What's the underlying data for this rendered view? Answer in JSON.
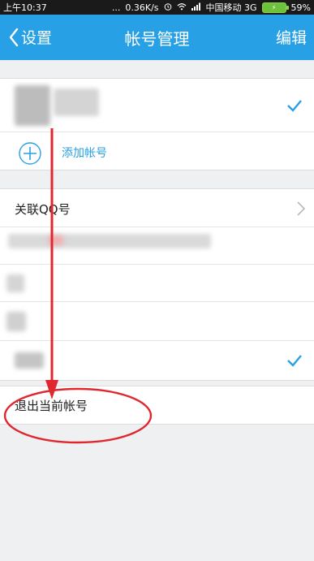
{
  "status_bar": {
    "time": "上午10:37",
    "dots": "...",
    "net_speed": "0.36K/s",
    "carrier": "中国移动 3G",
    "battery": "59%"
  },
  "nav": {
    "back_label": "设置",
    "title": "帐号管理",
    "edit_label": "编辑"
  },
  "accounts": {
    "add_label": "添加帐号"
  },
  "linked": {
    "label": "关联QQ号"
  },
  "logout": {
    "label": "退出当前帐号"
  },
  "colors": {
    "accent": "#27a0e5",
    "annotation": "#e0262f"
  },
  "icons": [
    "back-chevron-icon",
    "check-icon",
    "plus-circle-icon",
    "chevron-right-icon",
    "alarm-icon",
    "wifi-icon",
    "signal-icon",
    "battery-icon"
  ]
}
